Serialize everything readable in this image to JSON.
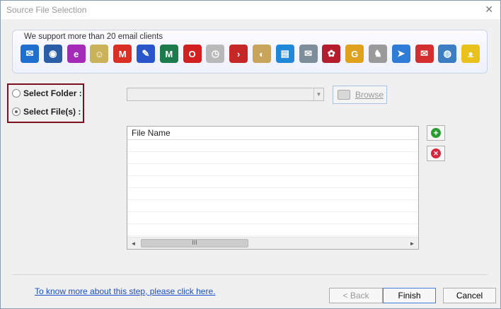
{
  "window": {
    "title": "Source File Selection",
    "close_glyph": "✕"
  },
  "banner": {
    "text": "We support more than 20 email clients",
    "clients": [
      {
        "icon": "mail-envelope-icon",
        "color": "#1f6fd0",
        "glyph": "✉"
      },
      {
        "icon": "thunderbird-icon",
        "color": "#2a5fa8",
        "glyph": "◉"
      },
      {
        "icon": "entourage-icon",
        "color": "#a32bb8",
        "glyph": "e"
      },
      {
        "icon": "people-contacts-icon",
        "color": "#c9b25a",
        "glyph": "☺"
      },
      {
        "icon": "gmail-icon",
        "color": "#d93025",
        "glyph": "M"
      },
      {
        "icon": "postbox-icon",
        "color": "#2b56c9",
        "glyph": "✎"
      },
      {
        "icon": "green-mail-icon",
        "color": "#1b7b4a",
        "glyph": "M"
      },
      {
        "icon": "opera-icon",
        "color": "#d21f1f",
        "glyph": "O"
      },
      {
        "icon": "mail-clock-icon",
        "color": "#b9b9b9",
        "glyph": "◷"
      },
      {
        "icon": "red-arrow-icon",
        "color": "#c62828",
        "glyph": "›"
      },
      {
        "icon": "seamonkey-icon",
        "color": "#c7a45a",
        "glyph": "◐"
      },
      {
        "icon": "blue-book-icon",
        "color": "#1f88d8",
        "glyph": "▤"
      },
      {
        "icon": "mailbox-icon",
        "color": "#7e8d9a",
        "glyph": "✉"
      },
      {
        "icon": "cluster-icon",
        "color": "#b51d2d",
        "glyph": "✿"
      },
      {
        "icon": "g-mail-client-icon",
        "color": "#e0a21d",
        "glyph": "G"
      },
      {
        "icon": "gnu-icon",
        "color": "#9a9a9a",
        "glyph": "♞"
      },
      {
        "icon": "paper-plane-icon",
        "color": "#2f7cd6",
        "glyph": "➤"
      },
      {
        "icon": "red-envelope-icon",
        "color": "#d32f2f",
        "glyph": "✉"
      },
      {
        "icon": "globe-mail-icon",
        "color": "#3d7ec2",
        "glyph": "◍"
      },
      {
        "icon": "the-bat-icon",
        "color": "#e8c21a",
        "glyph": "ᴥ"
      }
    ]
  },
  "source": {
    "select_folder_label": "Select Folder :",
    "select_files_label": "Select File(s) :",
    "selected": "files",
    "folder_path_value": "",
    "browse_label": "Browse"
  },
  "file_list": {
    "column_header": "File Name",
    "rows": [],
    "scroll_grip": "III",
    "scroll_left": "◄",
    "scroll_right": "►"
  },
  "actions": {
    "add_glyph": "+",
    "remove_glyph": "✕",
    "add_color": "#2a9d32",
    "remove_color": "#d7263d"
  },
  "footer": {
    "help_link": "To know more about this step, please click here.",
    "back_label": "< Back",
    "finish_label": "Finish",
    "cancel_label": "Cancel"
  }
}
